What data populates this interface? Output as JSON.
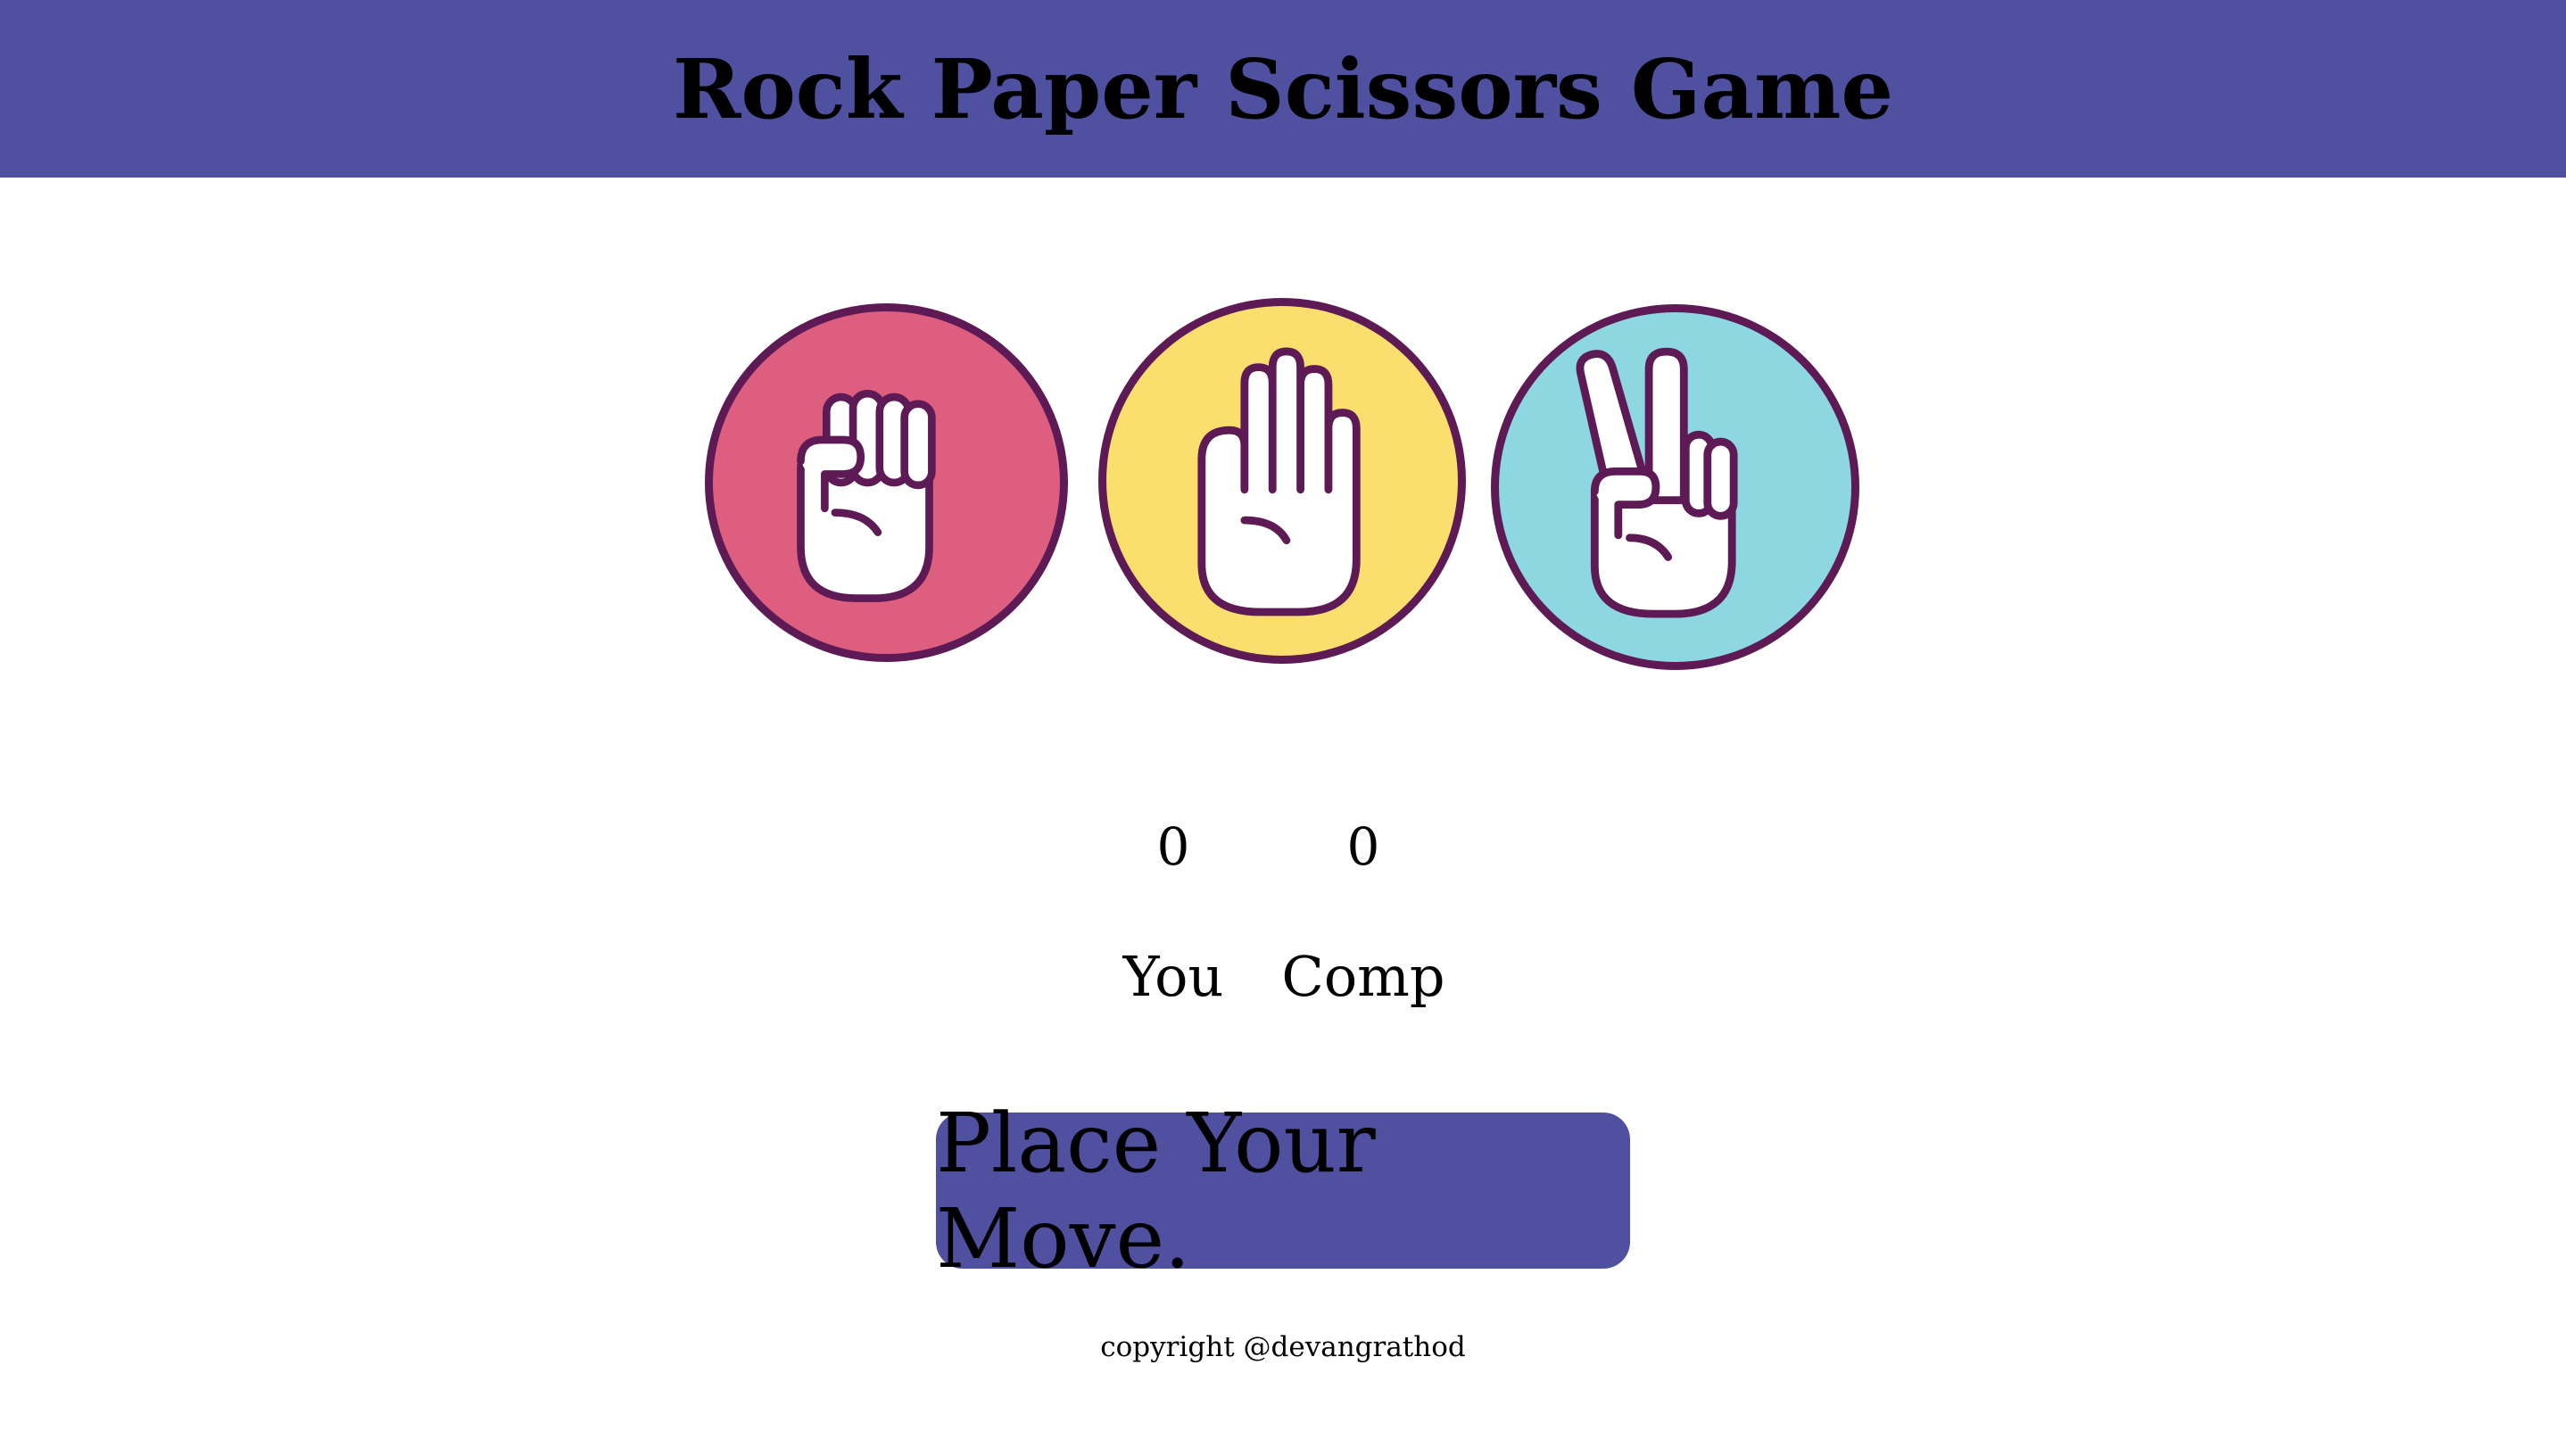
{
  "header": {
    "title": "Rock Paper Scissors Game"
  },
  "choices": [
    {
      "name": "rock",
      "icon": "fist-hand-icon",
      "color": "#de5e80"
    },
    {
      "name": "paper",
      "icon": "open-hand-icon",
      "color": "#fade6e"
    },
    {
      "name": "scissors",
      "icon": "victory-hand-icon",
      "color": "#8dd7e1"
    }
  ],
  "scoreboard": {
    "user_score": "0",
    "comp_score": "0",
    "user_label": "You",
    "comp_label": "Comp"
  },
  "message": {
    "text": "Place Your Move.",
    "color": "#4f50a0"
  },
  "footer": {
    "text": "copyright @devangrathod"
  },
  "colors": {
    "header_bg": "#4f50a0",
    "outline": "#5d1a55"
  }
}
